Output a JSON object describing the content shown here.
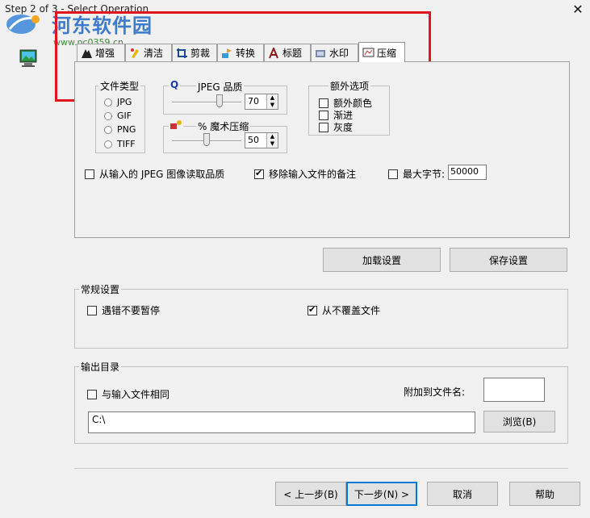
{
  "window": {
    "title": "Step 2 of 3 - Select Operation",
    "close_glyph": "✕"
  },
  "watermark": {
    "text": "河东软件园",
    "url": "www.pc0359.cn"
  },
  "tabs": [
    {
      "label": "增强",
      "icon": "enhance-icon"
    },
    {
      "label": "清洁",
      "icon": "clean-icon"
    },
    {
      "label": "剪裁",
      "icon": "crop-icon"
    },
    {
      "label": "转换",
      "icon": "convert-icon"
    },
    {
      "label": "标题",
      "icon": "caption-icon"
    },
    {
      "label": "水印",
      "icon": "watermark-icon"
    },
    {
      "label": "压缩",
      "icon": "compress-icon",
      "active": true
    }
  ],
  "compress": {
    "file_type": {
      "label": "文件类型",
      "options": [
        "JPG",
        "GIF",
        "PNG",
        "TIFF"
      ],
      "selected": "JPG"
    },
    "jpeg_quality": {
      "icon_glyph": "Q",
      "label": "JPEG 品质",
      "value": "70",
      "level": 70
    },
    "magic": {
      "label": "% 魔术压缩",
      "value": "50",
      "level": 50
    },
    "extra": {
      "label": "额外选项",
      "options": [
        {
          "label": "额外颜色",
          "checked": false
        },
        {
          "label": "渐进",
          "checked": false
        },
        {
          "label": "灰度",
          "checked": false
        }
      ]
    },
    "read_quality": {
      "label": "从输入的 JPEG 图像读取品质",
      "checked": false
    },
    "remove_comments": {
      "label": "移除输入文件的备注",
      "checked": true
    },
    "max_bytes": {
      "label": "最大字节:",
      "checked": false,
      "value": "50000"
    }
  },
  "settings_buttons": {
    "load": "加载设置",
    "save": "保存设置"
  },
  "general": {
    "label": "常规设置",
    "no_pause": {
      "label": "遇错不要暂停",
      "checked": false
    },
    "no_overwrite": {
      "label": "从不覆盖文件",
      "checked": true
    }
  },
  "output": {
    "label": "输出目录",
    "same_as_input": {
      "label": "与输入文件相同",
      "checked": false
    },
    "append_label": "附加到文件名:",
    "append_value": "",
    "path": "C:\\",
    "browse": "浏览(B)"
  },
  "nav": {
    "back": "< 上一步(B)",
    "next": "下一步(N) >",
    "cancel": "取消",
    "help": "帮助"
  },
  "colors": {
    "highlight": "#e0151f",
    "focus": "#0078d7"
  }
}
